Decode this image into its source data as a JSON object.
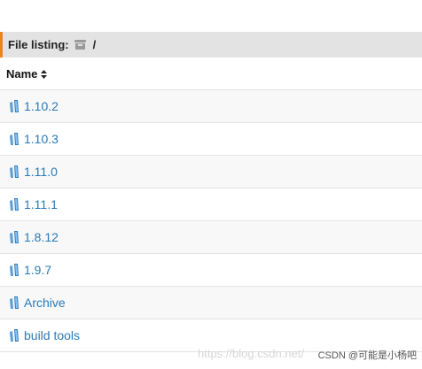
{
  "listing": {
    "title": "File listing:",
    "path": "/"
  },
  "columns": {
    "name": "Name"
  },
  "rows": [
    {
      "label": "1.10.2"
    },
    {
      "label": "1.10.3"
    },
    {
      "label": "1.11.0"
    },
    {
      "label": "1.11.1"
    },
    {
      "label": "1.8.12"
    },
    {
      "label": "1.9.7"
    },
    {
      "label": "Archive"
    },
    {
      "label": "build tools"
    }
  ],
  "watermark": {
    "url": "https://blog.csdn.net/",
    "credit": "CSDN @可能是小杨吧"
  },
  "colors": {
    "accent": "#f0821e",
    "link": "#2a7ab8",
    "header_bg": "#e3e3e3"
  },
  "icons": {
    "folder": "folder-icon",
    "root": "archive-box-icon",
    "sort": "sort-icon"
  }
}
